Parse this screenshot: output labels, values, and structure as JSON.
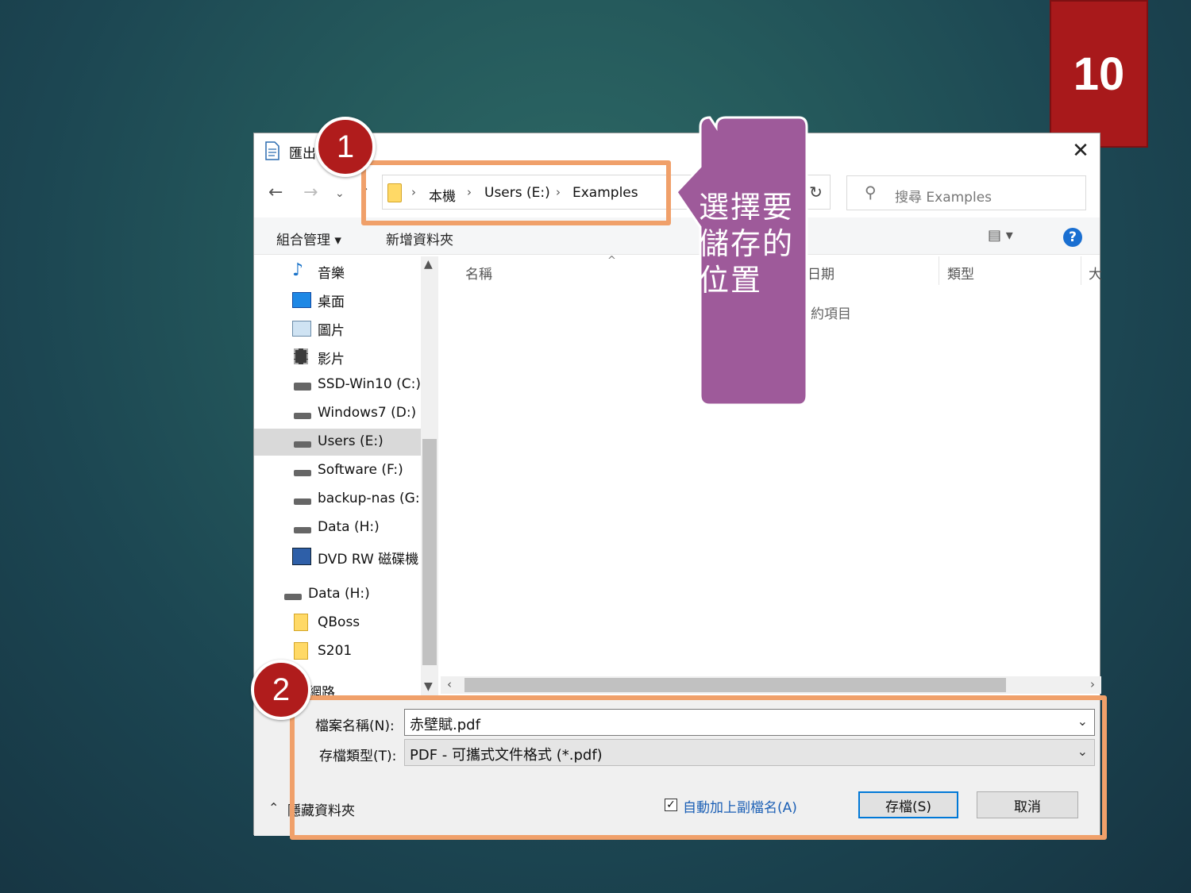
{
  "slide": {
    "number": "10"
  },
  "dialog": {
    "title": "匯出",
    "address": {
      "crumbs": [
        "本機",
        "Users (E:)",
        "Examples"
      ]
    },
    "search": {
      "placeholder": "搜尋 Examples"
    },
    "toolbar": {
      "organize": "組合管理 ▾",
      "new_folder": "新增資料夾"
    },
    "nav_pane": {
      "items": [
        {
          "label": "音樂",
          "icon": "music-icon"
        },
        {
          "label": "桌面",
          "icon": "desktop-icon"
        },
        {
          "label": "圖片",
          "icon": "pictures-icon"
        },
        {
          "label": "影片",
          "icon": "videos-icon"
        },
        {
          "label": "SSD-Win10 (C:)",
          "icon": "drive-icon"
        },
        {
          "label": "Windows7 (D:)",
          "icon": "drive-icon"
        },
        {
          "label": "Users (E:)",
          "icon": "drive-icon",
          "selected": true
        },
        {
          "label": "Software (F:)",
          "icon": "drive-icon"
        },
        {
          "label": "backup-nas (G:",
          "icon": "drive-icon"
        },
        {
          "label": "Data (H:)",
          "icon": "drive-icon"
        },
        {
          "label": "DVD RW 磁碟機",
          "icon": "dvd-icon"
        },
        {
          "label": "Data (H:)",
          "icon": "drive-icon"
        },
        {
          "label": "QBoss",
          "icon": "folder-icon"
        },
        {
          "label": "S201",
          "icon": "folder-icon"
        },
        {
          "label": "網路",
          "icon": "network-icon"
        }
      ]
    },
    "columns": {
      "name": "名稱",
      "date": "日期",
      "type": "類型",
      "size": "大"
    },
    "empty_message": "約項目",
    "file_name": {
      "label": "檔案名稱(N):",
      "value": "赤壁賦.pdf"
    },
    "file_type": {
      "label": "存檔類型(T):",
      "value": "PDF - 可攜式文件格式 (*.pdf)"
    },
    "auto_ext": {
      "label": "自動加上副檔名(A)",
      "checked": true
    },
    "hide_folders": "隱藏資料夾",
    "save_button": "存檔(S)",
    "cancel_button": "取消"
  },
  "annotations": {
    "step1": "1",
    "step2": "2",
    "callout_text": "選擇要儲存的位置",
    "highlight_color": "#f0a06a",
    "callout_color": "#9e5a9a",
    "circle_color": "#b01c1c"
  }
}
